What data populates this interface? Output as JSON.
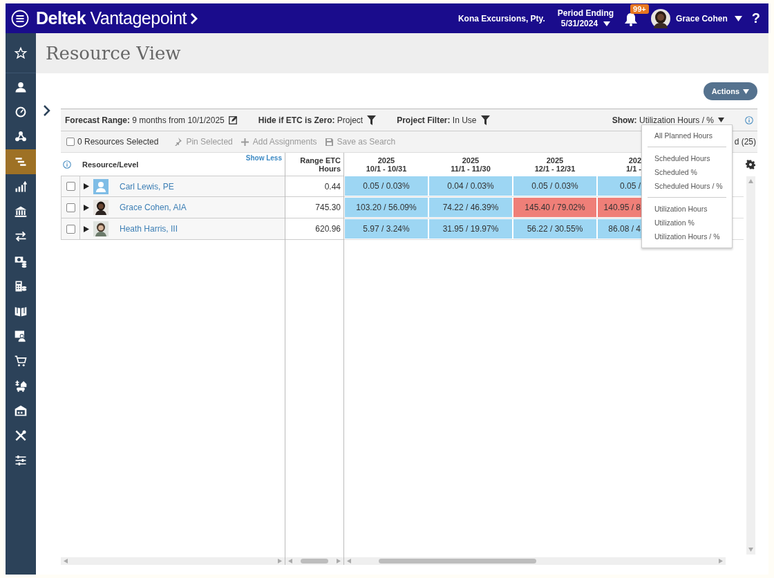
{
  "header": {
    "brand": "Deltek",
    "product": "Vantagepoint",
    "company": "Kona Excursions, Pty.",
    "period_label": "Period Ending",
    "period_value": "5/31/2024",
    "notification_badge": "99+",
    "user_name": "Grace Cohen",
    "help": "?"
  },
  "sidebar": {
    "items": [
      {
        "kind": "star",
        "selected": false
      },
      {
        "kind": "person",
        "selected": false
      },
      {
        "kind": "gauge",
        "selected": false
      },
      {
        "kind": "network",
        "selected": false
      },
      {
        "kind": "gantt",
        "selected": true
      },
      {
        "kind": "chart",
        "selected": false
      },
      {
        "kind": "bank",
        "selected": false
      },
      {
        "kind": "swap",
        "selected": false
      },
      {
        "kind": "money",
        "selected": false
      },
      {
        "kind": "calculator",
        "selected": false
      },
      {
        "kind": "book",
        "selected": false
      },
      {
        "kind": "presenter",
        "selected": false
      },
      {
        "kind": "cart",
        "selected": false
      },
      {
        "kind": "house",
        "selected": false
      },
      {
        "kind": "warehouse",
        "selected": false
      },
      {
        "kind": "tools",
        "selected": false
      },
      {
        "kind": "sliders",
        "selected": false
      }
    ]
  },
  "page": {
    "title": "Resource View",
    "actions_button": "Actions"
  },
  "filters": [
    {
      "label": "Forecast Range:",
      "value": "9 months from 10/1/2025",
      "kind": "edit"
    },
    {
      "label": "Hide if ETC is Zero:",
      "value": "Project",
      "kind": "filter"
    },
    {
      "label": "Project Filter:",
      "value": "In Use",
      "kind": "filter"
    }
  ],
  "show": {
    "label": "Show:",
    "value": "Utilization Hours / %"
  },
  "toolbar": {
    "select_all": {
      "label": "0 Resources Selected",
      "checked": false
    },
    "actions": [
      {
        "label": "Pin Selected",
        "kind": "pin",
        "disabled": true
      },
      {
        "label": "Add Assignments",
        "kind": "plus",
        "disabled": true
      },
      {
        "label": "Save as Search",
        "kind": "save",
        "disabled": true
      }
    ],
    "count_partial": "d (25)"
  },
  "table": {
    "resource_header": "Resource/Level",
    "show_less": "Show Less",
    "etc_header": [
      "Range ETC",
      "Hours"
    ],
    "periods": [
      {
        "year": "2025",
        "range": "10/1 - 10/31"
      },
      {
        "year": "2025",
        "range": "11/1 - 11/30"
      },
      {
        "year": "2025",
        "range": "12/1 - 12/31"
      },
      {
        "year": "202",
        "range": "1/1 - "
      }
    ],
    "rows": [
      {
        "name": "Carl Lewis, PE",
        "has_photo": false,
        "checked": false,
        "expanded": false,
        "etc": "0.44",
        "cells": [
          {
            "value": "0.05 / 0.03%",
            "over": false
          },
          {
            "value": "0.04 / 0.03%",
            "over": false
          },
          {
            "value": "0.05 / 0.03%",
            "over": false
          },
          {
            "value": "0.05 /",
            "over": false
          }
        ]
      },
      {
        "name": "Grace Cohen, AIA",
        "has_photo": true,
        "checked": false,
        "expanded": false,
        "etc": "745.30",
        "cells": [
          {
            "value": "103.20 / 56.09%",
            "over": false
          },
          {
            "value": "74.22 / 46.39%",
            "over": false
          },
          {
            "value": "145.40 / 79.02%",
            "over": true
          },
          {
            "value": "140.95 / 8",
            "over": true
          }
        ]
      },
      {
        "name": "Heath Harris, III",
        "has_photo": true,
        "checked": false,
        "expanded": false,
        "etc": "620.96",
        "cells": [
          {
            "value": "5.97 / 3.24%",
            "over": false
          },
          {
            "value": "31.95 / 19.97%",
            "over": false
          },
          {
            "value": "56.22 / 30.55%",
            "over": false
          },
          {
            "value": "86.08 / 4",
            "over": false
          }
        ]
      }
    ]
  },
  "show_menu": {
    "groups": [
      [
        "All Planned Hours"
      ],
      [
        "Scheduled Hours",
        "Scheduled %",
        "Scheduled Hours / %"
      ],
      [
        "Utilization Hours",
        "Utilization %",
        "Utilization Hours / %"
      ]
    ]
  }
}
